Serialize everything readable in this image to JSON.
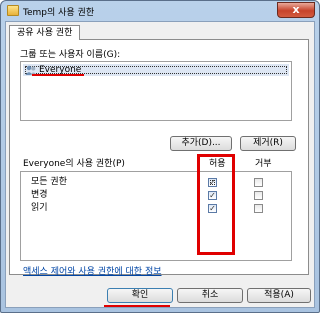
{
  "window": {
    "title": "Temp의 사용 권한",
    "close_symbol": "x"
  },
  "tab": {
    "label": "공유 사용 권한"
  },
  "users": {
    "group_label": "그룹 또는 사용자 이름(G):",
    "items": [
      {
        "name": "Everyone",
        "selected": true
      }
    ],
    "add_button": "추가(D)...",
    "remove_button": "제거(R)"
  },
  "permissions": {
    "title": "Everyone의 사용 권한(P)",
    "allow_header": "허용",
    "deny_header": "거부",
    "rows": [
      {
        "name": "모든 권한",
        "allow": true,
        "deny": false
      },
      {
        "name": "변경",
        "allow": true,
        "deny": false
      },
      {
        "name": "읽기",
        "allow": true,
        "deny": false
      }
    ]
  },
  "link_text": "액세스 제어와 사용 권한에 대한 정보",
  "buttons": {
    "ok": "확인",
    "cancel": "취소",
    "apply": "적용(A)"
  },
  "colors": {
    "annotation": "#e00000",
    "link": "#0045a5",
    "selection": "#dde6f3"
  }
}
